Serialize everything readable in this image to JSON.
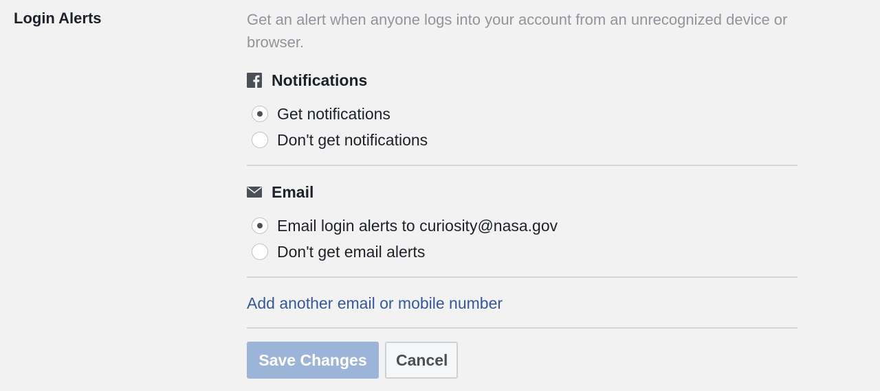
{
  "section": {
    "label": "Login Alerts",
    "description": "Get an alert when anyone logs into your account from an unrecognized device or browser."
  },
  "notifications": {
    "title": "Notifications",
    "icon": "facebook-icon",
    "options": [
      {
        "label": "Get notifications",
        "checked": true
      },
      {
        "label": "Don't get notifications",
        "checked": false
      }
    ]
  },
  "email": {
    "title": "Email",
    "icon": "envelope-icon",
    "options": [
      {
        "label": "Email login alerts to curiosity@nasa.gov",
        "checked": true
      },
      {
        "label": "Don't get email alerts",
        "checked": false
      }
    ]
  },
  "add_link": "Add another email or mobile number",
  "buttons": {
    "save": "Save Changes",
    "cancel": "Cancel"
  },
  "colors": {
    "background": "#f2f2f2",
    "link": "#365899",
    "save_button": "#9cb4d8",
    "muted_text": "#90949c"
  }
}
